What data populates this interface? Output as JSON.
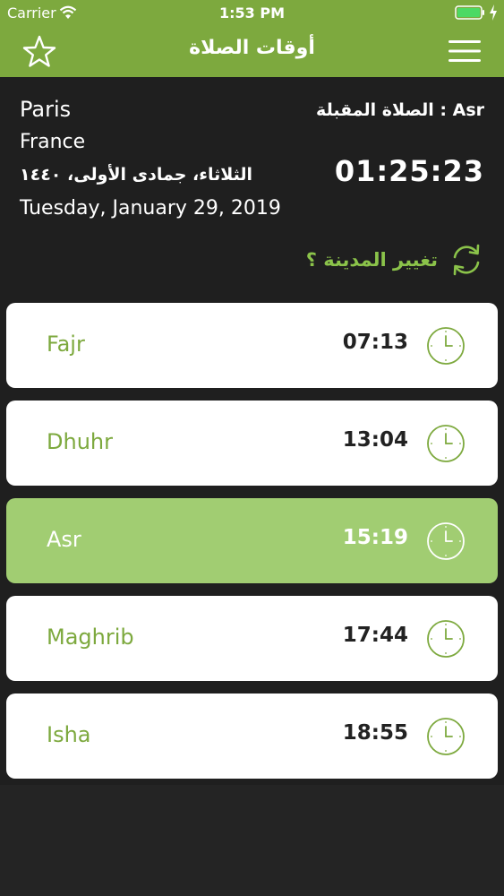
{
  "status_bar": {
    "carrier": "Carrier",
    "time": "1:53 PM"
  },
  "nav": {
    "title": "أوقات الصلاة"
  },
  "location": {
    "city": "Paris",
    "country": "France",
    "hijri_date": "الثلاثاء، جمادى الأولى، ١٤٤٠",
    "gregorian_date": "Tuesday, January 29, 2019"
  },
  "next_prayer": {
    "label": "الصلاة المقبلة : Asr",
    "countdown": "01:25:23"
  },
  "change_city": {
    "label": "تغيير المدينة ؟"
  },
  "prayers": [
    {
      "name": "Fajr",
      "time": "07:13",
      "active": false
    },
    {
      "name": "Dhuhr",
      "time": "13:04",
      "active": false
    },
    {
      "name": "Asr",
      "time": "15:19",
      "active": true
    },
    {
      "name": "Maghrib",
      "time": "17:44",
      "active": false
    },
    {
      "name": "Isha",
      "time": "18:55",
      "active": false
    }
  ],
  "colors": {
    "accent_green": "#7da93e",
    "active_row": "#a1cd72",
    "background": "#1f1f1f"
  },
  "icons": [
    "wifi-icon",
    "battery-icon",
    "star-icon",
    "menu-icon",
    "refresh-icon",
    "clock-icon"
  ]
}
